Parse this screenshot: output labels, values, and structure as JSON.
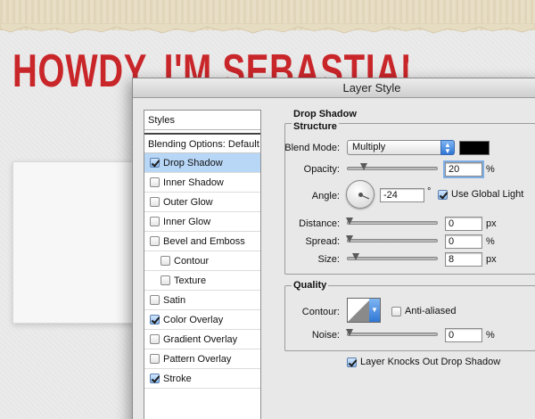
{
  "background": {
    "headline": "HOWDY, I'M SEBASTIANO, GR",
    "headline_color": "#c9262a"
  },
  "dialog": {
    "title": "Layer Style",
    "styles_panel": {
      "header": "Styles",
      "blending_options": "Blending Options: Default",
      "items": [
        {
          "label": "Drop Shadow",
          "checked": true,
          "selected": true,
          "indent": false
        },
        {
          "label": "Inner Shadow",
          "checked": false,
          "selected": false,
          "indent": false
        },
        {
          "label": "Outer Glow",
          "checked": false,
          "selected": false,
          "indent": false
        },
        {
          "label": "Inner Glow",
          "checked": false,
          "selected": false,
          "indent": false
        },
        {
          "label": "Bevel and Emboss",
          "checked": false,
          "selected": false,
          "indent": false
        },
        {
          "label": "Contour",
          "checked": false,
          "selected": false,
          "indent": true
        },
        {
          "label": "Texture",
          "checked": false,
          "selected": false,
          "indent": true
        },
        {
          "label": "Satin",
          "checked": false,
          "selected": false,
          "indent": false
        },
        {
          "label": "Color Overlay",
          "checked": true,
          "selected": false,
          "indent": false
        },
        {
          "label": "Gradient Overlay",
          "checked": false,
          "selected": false,
          "indent": false
        },
        {
          "label": "Pattern Overlay",
          "checked": false,
          "selected": false,
          "indent": false
        },
        {
          "label": "Stroke",
          "checked": true,
          "selected": false,
          "indent": false
        }
      ]
    },
    "drop_shadow": {
      "section_title": "Drop Shadow",
      "structure": {
        "title": "Structure",
        "blend_mode_label": "Blend Mode:",
        "blend_mode_value": "Multiply",
        "shadow_color": "#000000",
        "opacity_label": "Opacity:",
        "opacity_value": "20",
        "opacity_unit": "%",
        "angle_label": "Angle:",
        "angle_value": "-24",
        "angle_unit": "°",
        "use_global_light_label": "Use Global Light",
        "use_global_light_checked": true,
        "distance_label": "Distance:",
        "distance_value": "0",
        "distance_unit": "px",
        "spread_label": "Spread:",
        "spread_value": "0",
        "spread_unit": "%",
        "size_label": "Size:",
        "size_value": "8",
        "size_unit": "px"
      },
      "quality": {
        "title": "Quality",
        "contour_label": "Contour:",
        "anti_aliased_label": "Anti-aliased",
        "anti_aliased_checked": false,
        "noise_label": "Noise:",
        "noise_value": "0",
        "noise_unit": "%"
      },
      "knocks_out_label": "Layer Knocks Out Drop Shadow",
      "knocks_out_checked": true
    }
  },
  "colors": {
    "selection": "#b8d7f6",
    "accent_blue": "#2f77d6"
  }
}
